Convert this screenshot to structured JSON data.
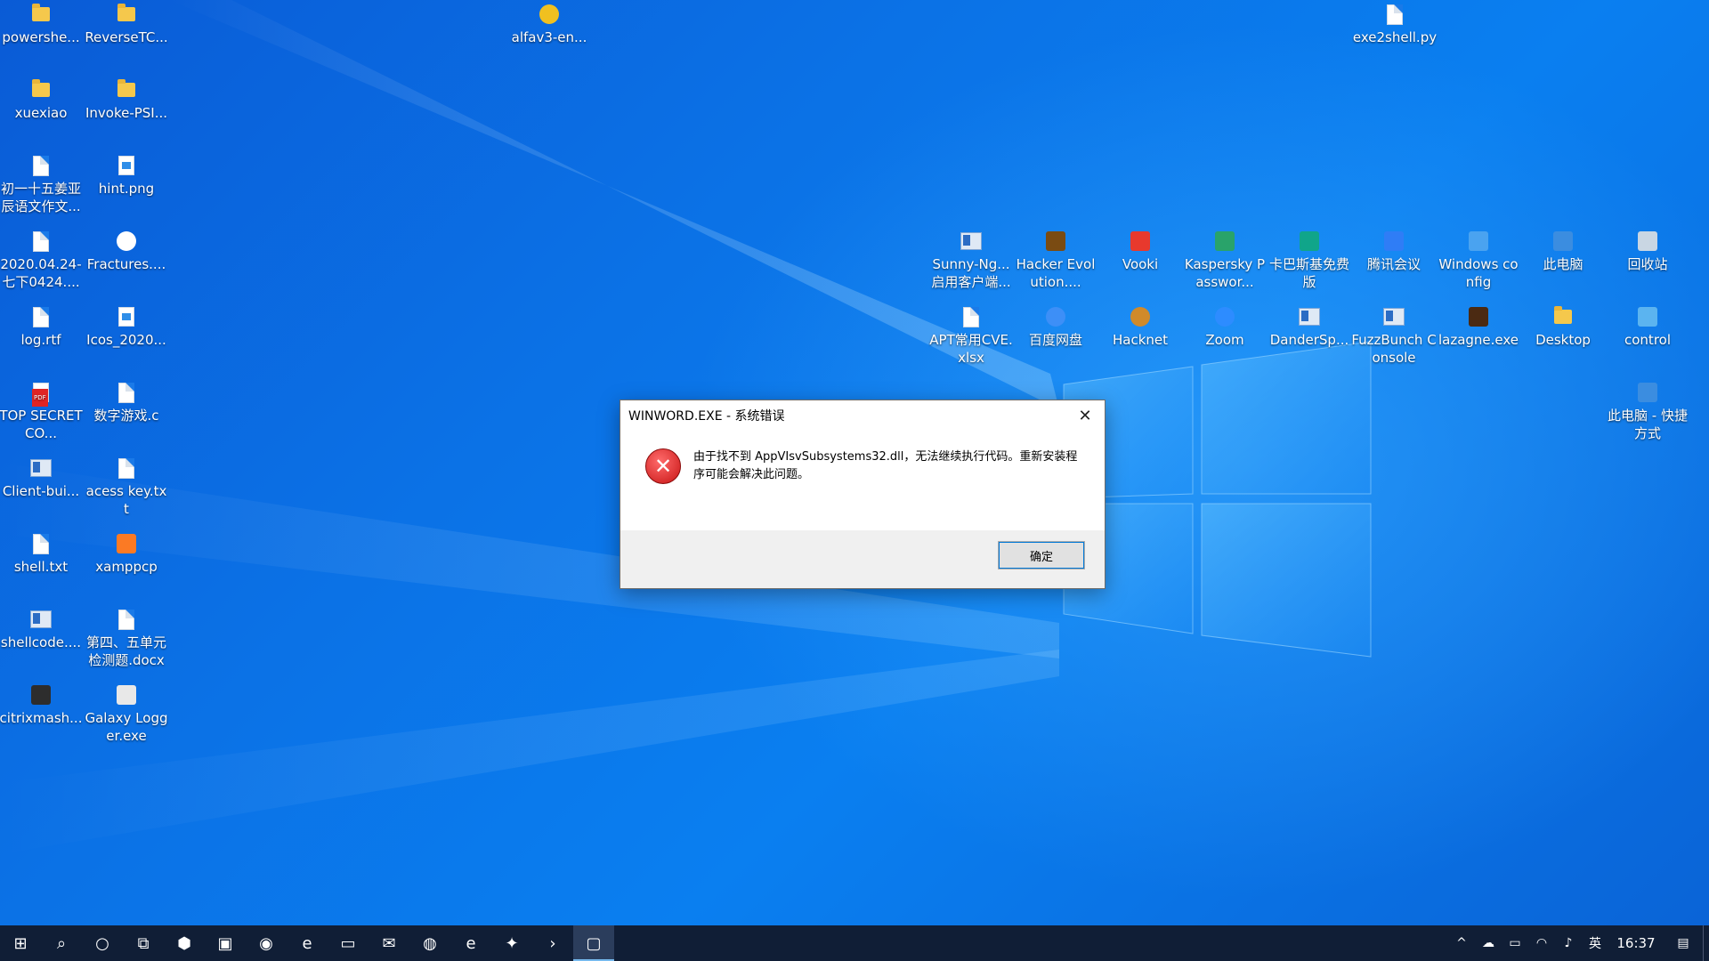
{
  "desktop": {
    "icons": [
      {
        "label": "powershe...",
        "kind": "folder"
      },
      {
        "label": "ReverseTC...",
        "kind": "folder"
      },
      {
        "label": "alfav3-en...",
        "kind": "round",
        "color": "#f0c020"
      },
      {
        "label": "exe2shell.py",
        "kind": "file"
      },
      {
        "label": "xuexiao",
        "kind": "folder"
      },
      {
        "label": "Invoke-PSI...",
        "kind": "folder"
      },
      {
        "label": "初一十五姜亚辰语文作文...",
        "kind": "file"
      },
      {
        "label": "hint.png",
        "kind": "img"
      },
      {
        "label": "2020.04.24-七下0424....",
        "kind": "file"
      },
      {
        "label": "Fractures....",
        "kind": "round",
        "color": "#ffffff"
      },
      {
        "label": "log.rtf",
        "kind": "file"
      },
      {
        "label": "Icos_2020...",
        "kind": "img"
      },
      {
        "label": "TOP SECRETCO...",
        "kind": "pdf"
      },
      {
        "label": "数字游戏.c",
        "kind": "file"
      },
      {
        "label": "Client-bui...",
        "kind": "app"
      },
      {
        "label": "acess key.txt",
        "kind": "file"
      },
      {
        "label": "shell.txt",
        "kind": "file"
      },
      {
        "label": "xamppcp",
        "kind": "sq",
        "color": "#fb7a24"
      },
      {
        "label": "shellcode....",
        "kind": "app"
      },
      {
        "label": "第四、五单元检测题.docx",
        "kind": "file"
      },
      {
        "label": "citrixmash...",
        "kind": "sq",
        "color": "#2d2d2d"
      },
      {
        "label": "Galaxy Logger.exe",
        "kind": "sq",
        "color": "#e8e8e8"
      },
      {
        "label": "Sunny-Ng...启用客户端...",
        "kind": "app"
      },
      {
        "label": "Hacker Evolution....",
        "kind": "sq",
        "color": "#7a4b12"
      },
      {
        "label": "Vooki",
        "kind": "sq",
        "color": "#e8392d"
      },
      {
        "label": "Kaspersky Passwor...",
        "kind": "sq",
        "color": "#29a36a"
      },
      {
        "label": "卡巴斯基免费版",
        "kind": "sq",
        "color": "#10a58a"
      },
      {
        "label": "腾讯会议",
        "kind": "sq",
        "color": "#2f7df6"
      },
      {
        "label": "Windows config",
        "kind": "sq",
        "color": "#4aa3f0"
      },
      {
        "label": "此电脑",
        "kind": "sq",
        "color": "#3b8de0"
      },
      {
        "label": "回收站",
        "kind": "sq",
        "color": "#c9d6e3"
      },
      {
        "label": "APT常用CVE.xlsx",
        "kind": "file"
      },
      {
        "label": "百度网盘",
        "kind": "round",
        "color": "#3d8ff7"
      },
      {
        "label": "Hacknet",
        "kind": "round",
        "color": "#d08a2a"
      },
      {
        "label": "Zoom",
        "kind": "round",
        "color": "#2d8cff"
      },
      {
        "label": "DanderSp...",
        "kind": "app"
      },
      {
        "label": "FuzzBunch Console",
        "kind": "app"
      },
      {
        "label": "lazagne.exe",
        "kind": "sq",
        "color": "#4b2a12"
      },
      {
        "label": "Desktop",
        "kind": "folder"
      },
      {
        "label": "control",
        "kind": "sq",
        "color": "#5bb4f0"
      },
      {
        "label": "此电脑 - 快捷方式",
        "kind": "sq",
        "color": "#3b8de0"
      }
    ]
  },
  "dialog": {
    "title": "WINWORD.EXE - 系统错误",
    "message": "由于找不到 AppVIsvSubsystems32.dll，无法继续执行代码。重新安装程序可能会解决此问题。",
    "ok_label": "确定",
    "close_glyph": "✕",
    "error_glyph": "✕"
  },
  "taskbar": {
    "apps": [
      {
        "name": "start",
        "glyph": "⊞"
      },
      {
        "name": "search",
        "glyph": "⌕"
      },
      {
        "name": "cortana",
        "glyph": "○"
      },
      {
        "name": "task-view",
        "glyph": "⧉"
      },
      {
        "name": "app-shield",
        "glyph": "⬢"
      },
      {
        "name": "app-photo",
        "glyph": "▣"
      },
      {
        "name": "app-tor",
        "glyph": "◉"
      },
      {
        "name": "app-edge",
        "glyph": "e"
      },
      {
        "name": "file-explorer",
        "glyph": "▭"
      },
      {
        "name": "mail",
        "glyph": "✉"
      },
      {
        "name": "wechat",
        "glyph": "◍"
      },
      {
        "name": "internet-explorer",
        "glyph": "e"
      },
      {
        "name": "app-game",
        "glyph": "✦"
      },
      {
        "name": "powershell",
        "glyph": "›"
      },
      {
        "name": "active-window",
        "glyph": "▢"
      }
    ],
    "tray": {
      "chevron": "^",
      "cloud": "☁",
      "battery": "▭",
      "wifi": "◠",
      "volume": "♪",
      "ime": "英",
      "time": "16:37",
      "notifications": "▤"
    }
  }
}
